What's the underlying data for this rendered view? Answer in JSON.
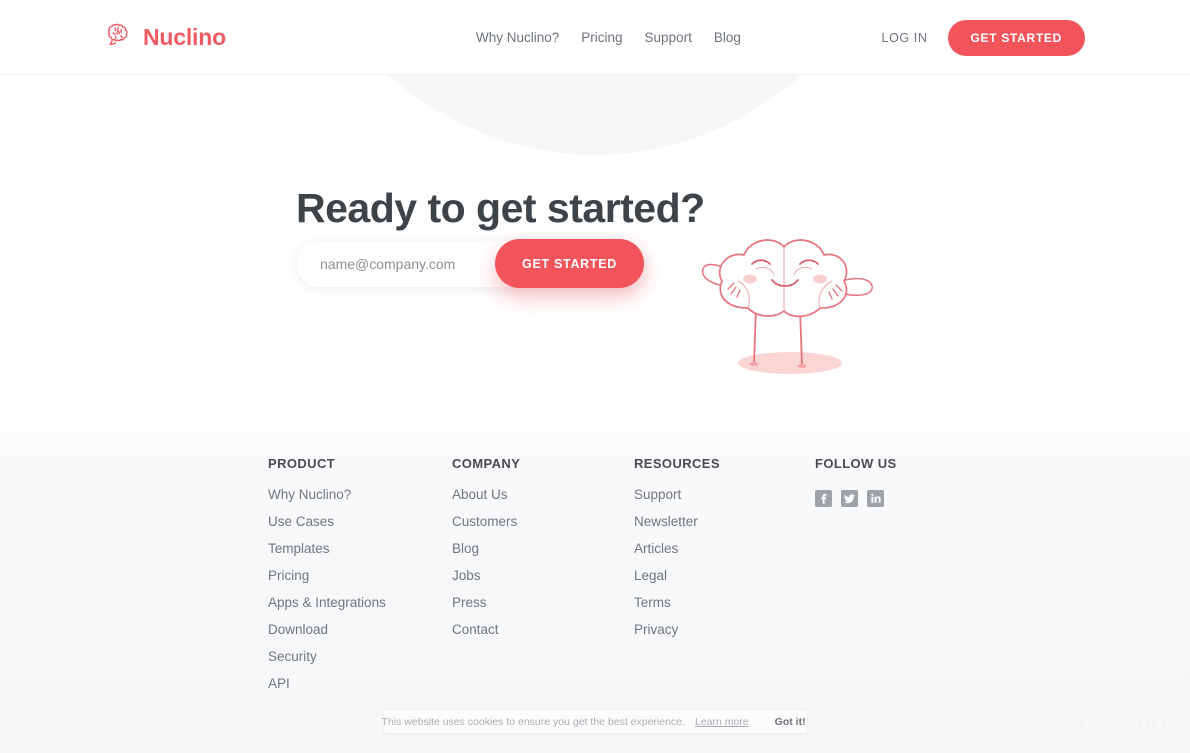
{
  "brand": {
    "name": "Nuclino",
    "logo_icon": "brain-speech-bubble-icon",
    "accent_color": "#f2545b",
    "heading_color": "#3e4348",
    "muted_text_color": "#70767d",
    "footer_bg_color": "#f6f7f9"
  },
  "header": {
    "nav": [
      {
        "label": "Why Nuclino?",
        "name": "nav-why-nuclino"
      },
      {
        "label": "Pricing",
        "name": "nav-pricing"
      },
      {
        "label": "Support",
        "name": "nav-support"
      },
      {
        "label": "Blog",
        "name": "nav-blog"
      }
    ],
    "login_label": "LOG IN",
    "cta_label": "GET STARTED"
  },
  "hero": {
    "title": "Ready to get started?",
    "email_placeholder": "name@company.com",
    "email_value": "",
    "cta_label": "GET STARTED",
    "illustration": "cloud-brain-mascot-illustration"
  },
  "footer": {
    "columns": [
      {
        "title": "PRODUCT",
        "links": [
          "Why Nuclino?",
          "Use Cases",
          "Templates",
          "Pricing",
          "Apps & Integrations",
          "Download",
          "Security",
          "API"
        ]
      },
      {
        "title": "COMPANY",
        "links": [
          "About Us",
          "Customers",
          "Blog",
          "Jobs",
          "Press",
          "Contact"
        ]
      },
      {
        "title": "RESOURCES",
        "links": [
          "Support",
          "Newsletter",
          "Articles",
          "Legal",
          "Terms",
          "Privacy"
        ]
      }
    ],
    "follow": {
      "title": "FOLLOW US",
      "socials": [
        {
          "name": "facebook-icon",
          "label": "Facebook"
        },
        {
          "name": "twitter-icon",
          "label": "Twitter"
        },
        {
          "name": "linkedin-icon",
          "label": "LinkedIn"
        }
      ]
    }
  },
  "cookie_banner": {
    "message": "This website uses cookies to ensure you get the best experience.",
    "learn_more_label": "Learn more",
    "accept_label": "Got it!"
  },
  "watermark": {
    "text": "Revain",
    "icon": "revain-logo-icon"
  }
}
